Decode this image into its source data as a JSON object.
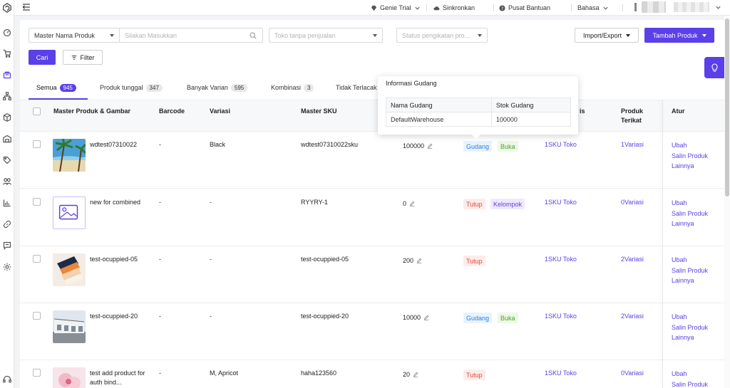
{
  "topbar": {
    "genie_trial": "Genie Trial",
    "sync": "Sinkronkan",
    "help": "Pusat Bantuan",
    "language": "Bahasa"
  },
  "filters": {
    "master_select": "Master Nama Produk",
    "search_placeholder": "Silakan Masukkan",
    "store_placeholder": "Toko tanpa penjualan",
    "status_placeholder": "Status pengikatan pro...",
    "import_export": "Import/Export",
    "add_product": "Tambah Produk",
    "search_button": "Cari",
    "filter_button": "Filter"
  },
  "tabs": [
    {
      "label": "Semua",
      "count": "945"
    },
    {
      "label": "Produk tunggal",
      "count": "347"
    },
    {
      "label": "Banyak Varian",
      "count": "595"
    },
    {
      "label": "Kombinasi",
      "count": "3"
    },
    {
      "label": "Tidak Terlacak",
      "count": ""
    }
  ],
  "columns": {
    "product": "Master Produk & Gambar",
    "barcode": "Barcode",
    "variation": "Variasi",
    "sku": "Master SKU",
    "store_col": "is",
    "linked": "Produk Terikat",
    "action": "Atur"
  },
  "popover": {
    "title": "Informasi Gudang",
    "col1": "Nama Gudang",
    "col2": "Stok Gudang",
    "warehouse": "DefaultWarehouse",
    "stock": "100000"
  },
  "rows": [
    {
      "name": "wdtest07310022",
      "barcode": "-",
      "variation": "Black",
      "sku": "wdtest07310022sku",
      "stock": "100000",
      "tag1": "Gudang",
      "tag2": "Buka",
      "store_sku": "1SKU Toko",
      "linked": "1Variasi"
    },
    {
      "name": "new for combined",
      "barcode": "-",
      "variation": "-",
      "sku": "RYYRY-1",
      "stock": "0",
      "tag1": "Tutup",
      "tag2": "Kelompok",
      "store_sku": "1SKU Toko",
      "linked": "0Variasi"
    },
    {
      "name": "test-ocuppied-05",
      "barcode": "-",
      "variation": "-",
      "sku": "test-ocuppied-05",
      "stock": "200",
      "tag1": "Tutup",
      "tag2": "",
      "store_sku": "1SKU Toko",
      "linked": "2Variasi"
    },
    {
      "name": "test-ocuppied-20",
      "barcode": "-",
      "variation": "-",
      "sku": "test-ocuppied-20",
      "stock": "10000",
      "tag1": "Gudang",
      "tag2": "Buka",
      "store_sku": "1SKU Toko",
      "linked": "2Variasi"
    },
    {
      "name": "test add product for auth bind...",
      "barcode": "-",
      "variation": "M, Apricot",
      "sku": "haha123560",
      "stock": "20",
      "tag1": "Tutup",
      "tag2": "",
      "store_sku": "1SKU Toko",
      "linked": "0Variasi"
    }
  ],
  "actions": {
    "edit": "Ubah",
    "copy": "Salin Produk",
    "more": "Lainnya"
  },
  "colors": {
    "accent": "#5b3fe8",
    "gudang": "#2f7fd9",
    "buka": "#4aa12f",
    "tutup": "#e0483c"
  }
}
